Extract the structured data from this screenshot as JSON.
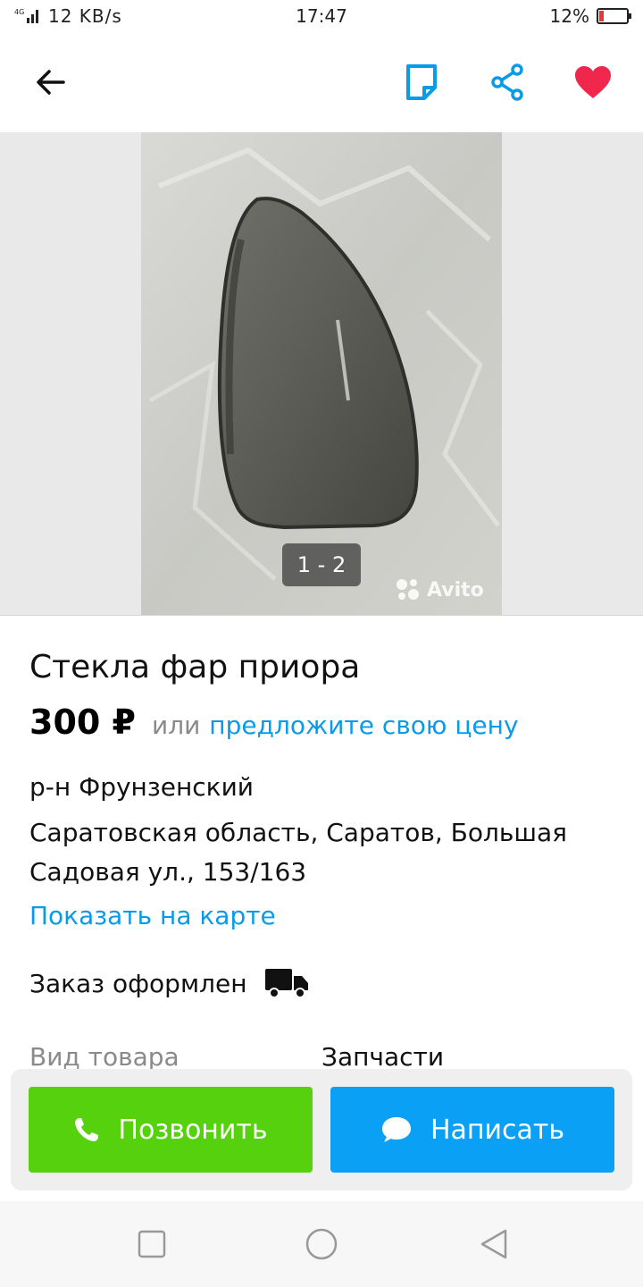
{
  "status_bar": {
    "network": "4G",
    "speed": "12 KB/s",
    "time": "17:47",
    "battery": "12%"
  },
  "gallery": {
    "counter": "1 - 2",
    "watermark": "Avito"
  },
  "listing": {
    "title": "Стекла фар приора",
    "price": "300 ₽",
    "or_text": "или",
    "offer_link": "предложите свою цену",
    "district": "р-н Фрунзенский",
    "address": "Саратовская область, Саратов, Большая Садовая ул., 153/163",
    "map_link": "Показать на карте",
    "order_status": "Заказ оформлен",
    "spec_label": "Вид товара",
    "spec_value": "Запчасти"
  },
  "actions": {
    "call_label": "Позвонить",
    "write_label": "Написать"
  },
  "colors": {
    "accent_blue": "#0a9be8",
    "favorite_red": "#f0264d",
    "call_green": "#55d10e",
    "write_blue": "#0aa0f5"
  },
  "icons": {
    "back": "back-arrow-icon",
    "note": "note-icon",
    "share": "share-icon",
    "favorite": "heart-icon",
    "delivery": "truck-icon",
    "call": "phone-icon",
    "write": "chat-bubble-icon"
  }
}
